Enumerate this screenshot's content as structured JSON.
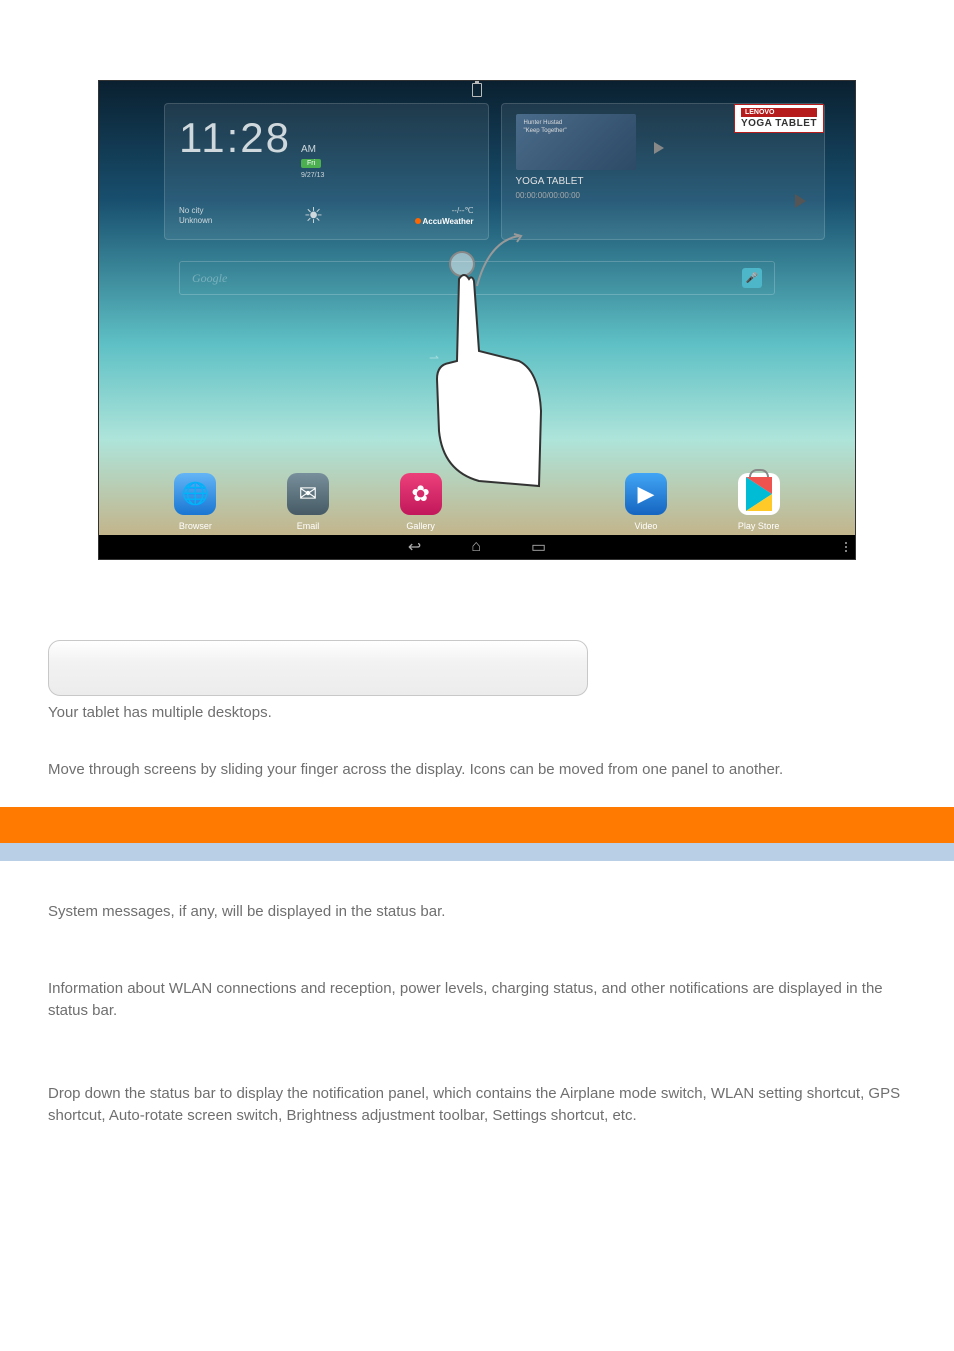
{
  "tablet": {
    "clock": {
      "time": "11:28",
      "ampm": "AM",
      "day": "Fri",
      "date": "9/27/13"
    },
    "weather": {
      "city_line1": "No city",
      "city_line2": "Unknown",
      "temp": "--/--℃",
      "provider": "AccuWeather"
    },
    "yoga": {
      "brand": "LENOVO",
      "product": "YOGA TABLET",
      "thumb_line1": "Hunter Hustad",
      "thumb_line2": "\"Keep Together\"",
      "title": "YOGA TABLET",
      "time": "00:00:00/00:00:00"
    },
    "search_placeholder": "Google",
    "dock": {
      "browser": "Browser",
      "email": "Email",
      "gallery": "Gallery",
      "video": "Video",
      "play": "Play Store"
    }
  },
  "body": {
    "p1": "Your tablet has multiple desktops.",
    "p2": "Move through screens by sliding your finger across the display. Icons can be moved from one panel to another.",
    "p3": "System messages, if any, will be displayed in the status bar.",
    "p4": "Information about WLAN connections and reception, power levels, charging status, and other notifications are displayed in the status bar.",
    "p5": "Drop down the status bar to display the notification panel, which contains the Airplane mode switch, WLAN setting shortcut, GPS shortcut, Auto-rotate screen switch, Brightness adjustment toolbar, Settings shortcut, etc."
  }
}
